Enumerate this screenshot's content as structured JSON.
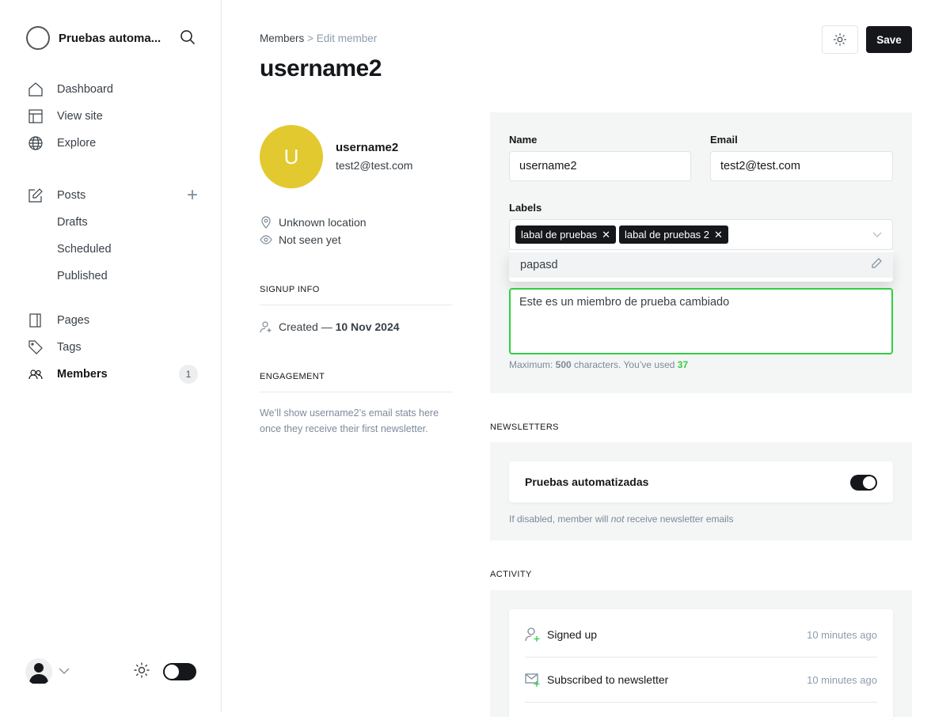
{
  "sidebar": {
    "site_name": "Pruebas automa...",
    "nav": [
      {
        "label": "Dashboard",
        "icon": "home-icon"
      },
      {
        "label": "View site",
        "icon": "layout-icon"
      },
      {
        "label": "Explore",
        "icon": "globe-icon"
      }
    ],
    "posts": {
      "label": "Posts",
      "sub": [
        "Drafts",
        "Scheduled",
        "Published"
      ]
    },
    "more": [
      {
        "label": "Pages"
      },
      {
        "label": "Tags"
      },
      {
        "label": "Members",
        "count": "1"
      }
    ]
  },
  "header": {
    "breadcrumb_parent": "Members",
    "breadcrumb_sep": ">",
    "breadcrumb_current": "Edit member",
    "title": "username2",
    "save_label": "Save"
  },
  "member": {
    "initial": "U",
    "name": "username2",
    "email": "test2@test.com",
    "location": "Unknown location",
    "seen": "Not seen yet",
    "avatar_color": "#e2c92f"
  },
  "signup": {
    "heading": "Signup info",
    "created_prefix": "Created — ",
    "created_date": "10 Nov 2024"
  },
  "engagement": {
    "heading": "Engagement",
    "text": "We’ll show username2’s email stats here once they receive their first newsletter."
  },
  "form": {
    "name_label": "Name",
    "name_value": "username2",
    "email_label": "Email",
    "email_value": "test2@test.com",
    "labels_label": "Labels",
    "labels": [
      "labal de pruebas",
      "labal de pruebas 2"
    ],
    "dropdown_option": "papasd",
    "note_value": "Este es un miembro de prueba cambiado",
    "hint_prefix": "Maximum: ",
    "hint_max": "500",
    "hint_mid": " characters. You’ve used ",
    "hint_used": "37"
  },
  "newsletters": {
    "heading": "Newsletters",
    "name": "Pruebas automatizadas",
    "enabled": true,
    "hint_a": "If disabled, member will ",
    "hint_em": "not",
    "hint_b": " receive newsletter emails"
  },
  "activity": {
    "heading": "Activity",
    "items": [
      {
        "label": "Signed up",
        "time": "10 minutes ago"
      },
      {
        "label": "Subscribed to newsletter",
        "time": "10 minutes ago"
      }
    ]
  }
}
